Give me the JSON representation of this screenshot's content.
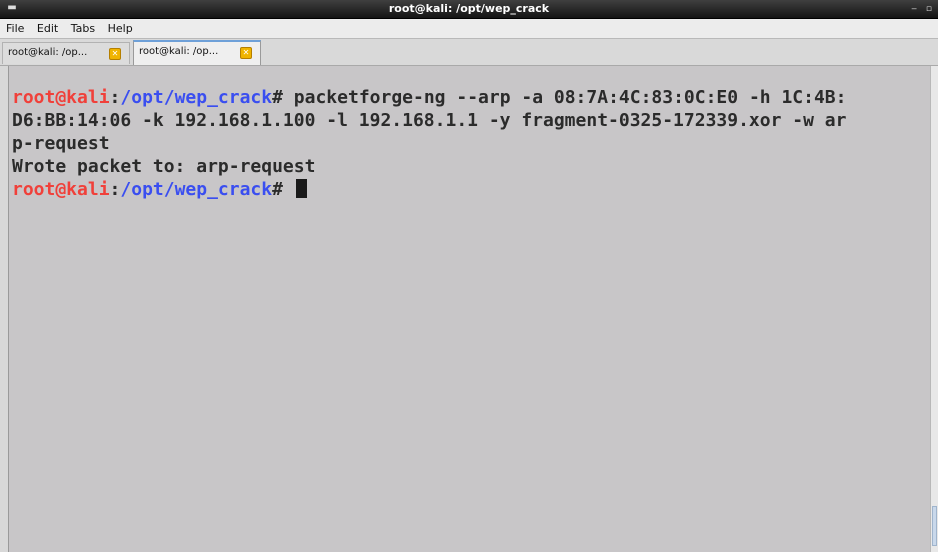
{
  "window": {
    "title": "root@kali: /opt/wep_crack",
    "app_icon": "terminal-app-icon",
    "minimize_glyph": "‒",
    "maximize_glyph": "▫"
  },
  "menu": {
    "file": "File",
    "edit": "Edit",
    "tabs": "Tabs",
    "help": "Help"
  },
  "tabs": [
    {
      "label": "root@kali: /op...",
      "active": false
    },
    {
      "label": "root@kali: /op...",
      "active": true
    }
  ],
  "terminal": {
    "prompt_user": "root@kali",
    "prompt_sep": ":",
    "prompt_path": "/opt/wep_crack",
    "prompt_end": "# ",
    "command_line_1": "packetforge-ng --arp -a 08:7A:4C:83:0C:E0 -h 1C:4B:",
    "command_line_2": "D6:BB:14:06 -k 192.168.1.100 -l 192.168.1.1 -y fragment-0325-172339.xor -w ar",
    "command_line_3": "p-request",
    "output_line": "Wrote packet to: arp-request"
  },
  "colors": {
    "prompt_user": "#f0403a",
    "prompt_path": "#3a4ef0",
    "terminal_bg": "#c8c6c8",
    "text": "#2b2b2b",
    "tab_close": "#f0b400"
  }
}
